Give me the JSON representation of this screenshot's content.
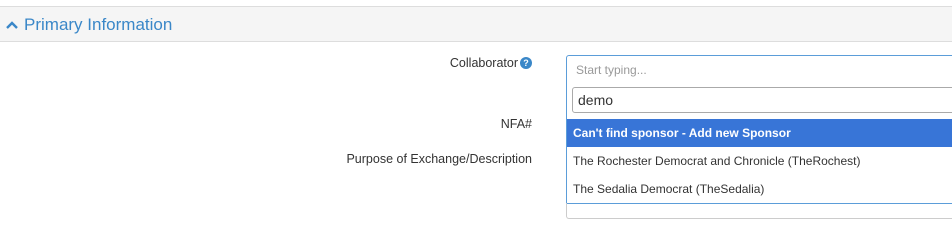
{
  "panel": {
    "title": "Primary Information",
    "icon": "chevron-up-icon",
    "accent_color": "#3a87c8"
  },
  "form": {
    "collaborator_label": "Collaborator",
    "help_icon": "question-circle-icon",
    "help_glyph": "?",
    "nfa_label": "NFA#",
    "purpose_label": "Purpose of Exchange/Description"
  },
  "select": {
    "placeholder": "Start typing...",
    "search_value": "demo",
    "options": [
      {
        "label": "Can't find sponsor - Add new Sponsor",
        "highlighted": true
      },
      {
        "label": "The Rochester Democrat and Chronicle (TheRochest)",
        "highlighted": false
      },
      {
        "label": "The Sedalia Democrat (TheSedalia)",
        "highlighted": false
      }
    ],
    "highlight_color": "#3875d7"
  }
}
